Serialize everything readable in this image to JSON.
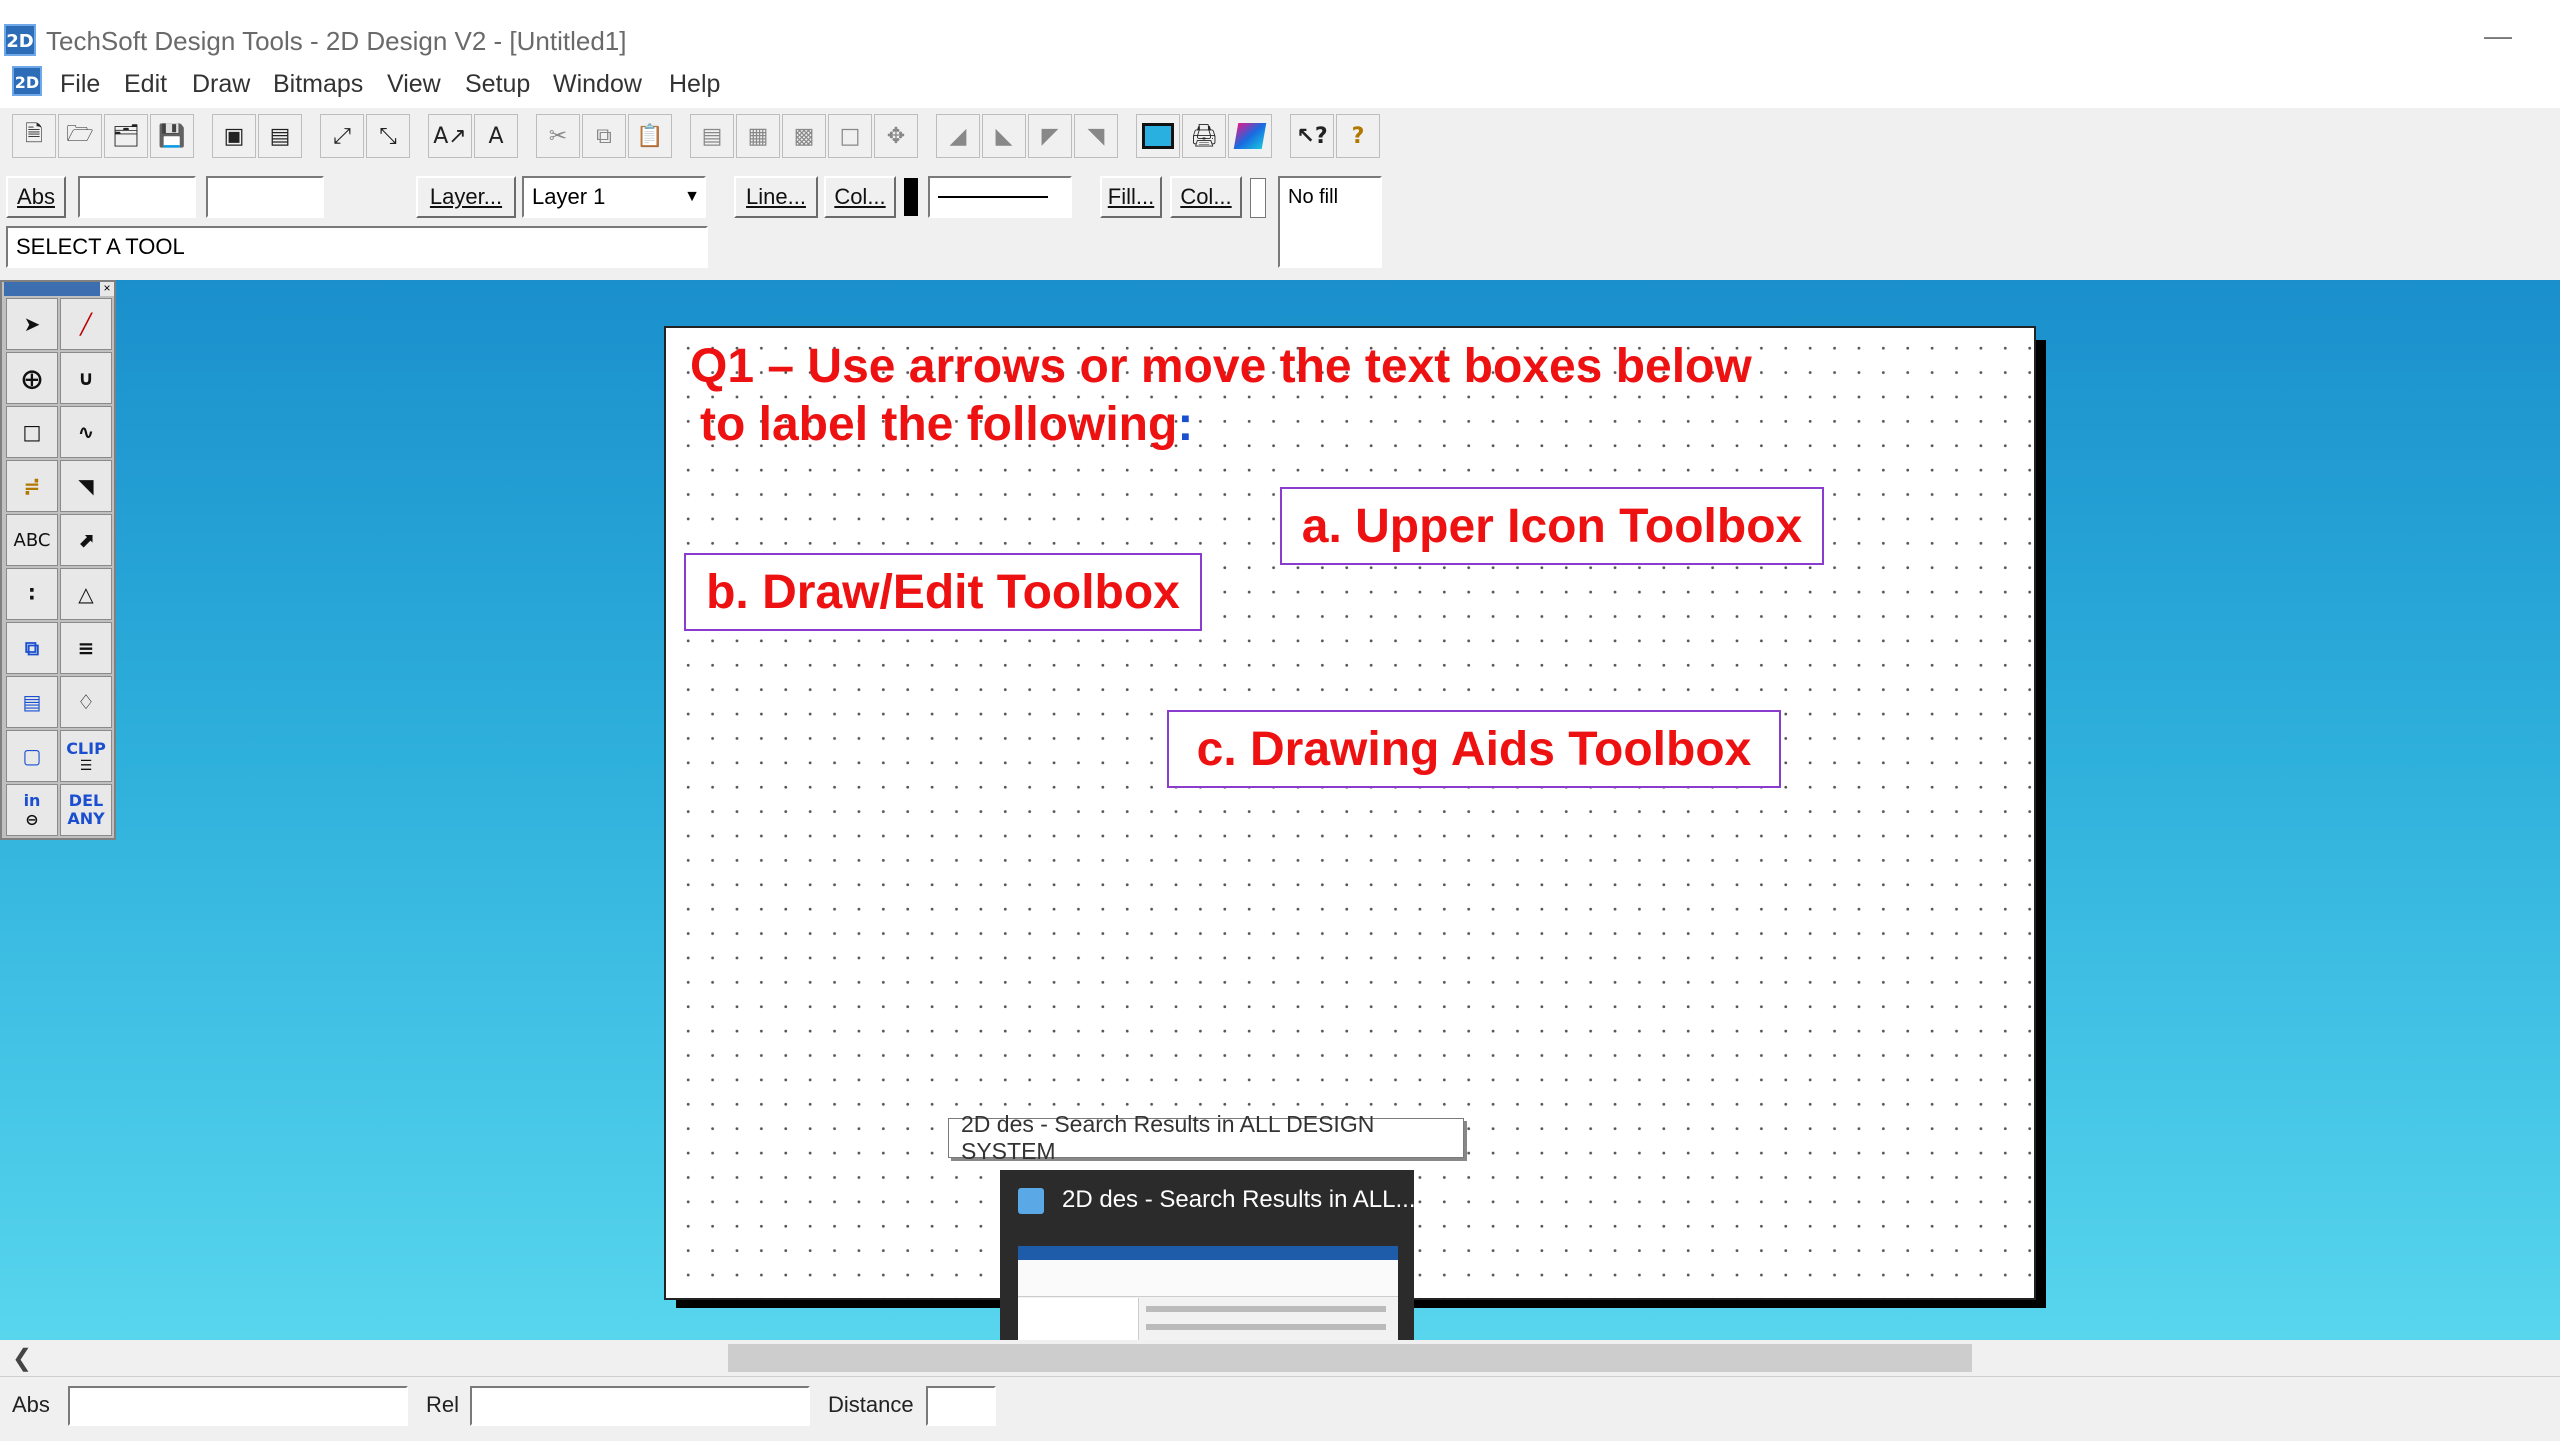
{
  "window": {
    "title": "TechSoft Design Tools - 2D Design V2 - [Untitled1]",
    "app_icon": "2D"
  },
  "menu": [
    "File",
    "Edit",
    "Draw",
    "Bitmaps",
    "View",
    "Setup",
    "Window",
    "Help"
  ],
  "attr_bar": {
    "abs_label": "Abs",
    "layer_button": "Layer...",
    "layer_value": "Layer 1",
    "line_button": "Line...",
    "col_button": "Col...",
    "fill_button": "Fill...",
    "col2_button": "Col...",
    "fill_value": "No fill",
    "prompt": "SELECT A TOOL"
  },
  "toolbox": {
    "text_tool": "ABC",
    "clip_tool": "CLIP",
    "in_tool": "in",
    "del_tool_1": "DEL",
    "del_tool_2": "ANY"
  },
  "sheet": {
    "question_line1": "Q1 – Use arrows or move the text boxes below",
    "question_line2": " to label the following",
    "question_colon": ":",
    "label_a": "a. Upper Icon Toolbox",
    "label_b": "b. Draw/Edit Toolbox",
    "label_c": "c. Drawing Aids Toolbox"
  },
  "taskbar_preview": {
    "tooltip": "2D des - Search Results in ALL DESIGN SYSTEM",
    "title": "2D des - Search Results in ALL..."
  },
  "status": {
    "abs": "Abs",
    "rel": "Rel",
    "distance": "Distance"
  },
  "colors": {
    "workspace_top": "#1a8fcc",
    "workspace_bottom": "#58d6ee",
    "label_red": "#ee1111",
    "box_border": "#8a3ccf"
  }
}
